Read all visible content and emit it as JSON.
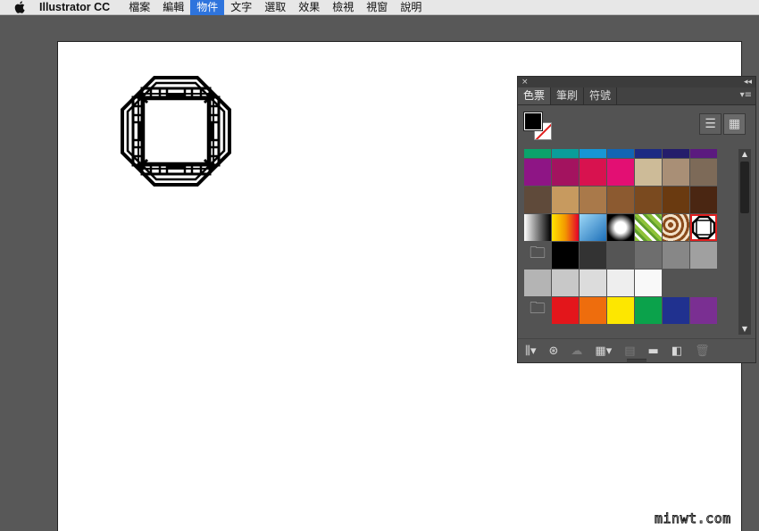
{
  "menubar": {
    "app_name": "Illustrator CC",
    "items": [
      {
        "label": "檔案",
        "active": false
      },
      {
        "label": "編輯",
        "active": false
      },
      {
        "label": "物件",
        "active": true
      },
      {
        "label": "文字",
        "active": false
      },
      {
        "label": "選取",
        "active": false
      },
      {
        "label": "效果",
        "active": false
      },
      {
        "label": "檢視",
        "active": false
      },
      {
        "label": "視窗",
        "active": false
      },
      {
        "label": "說明",
        "active": false
      }
    ]
  },
  "panel": {
    "close_glyph": "×",
    "collapse_glyph": "◂◂",
    "menu_glyph": "▾≡",
    "tabs": [
      {
        "label": "色票",
        "active": true
      },
      {
        "label": "筆刷",
        "active": false
      },
      {
        "label": "符號",
        "active": false
      }
    ],
    "view_list_glyph": "☰",
    "view_grid_glyph": "▦",
    "fill_color": "#000000",
    "stroke": "none",
    "swatch_rows": [
      {
        "kind": "top",
        "cells": [
          "#0aa36b",
          "#0a9d9a",
          "#1796d5",
          "#1265b4",
          "#1c2a83",
          "#241d6b",
          "#5b1a7f"
        ]
      },
      {
        "kind": "color",
        "cells": [
          "#8e1585",
          "#a3135f",
          "#d8124f",
          "#e30f73",
          "#cdbb98",
          "#a98f76",
          "#7d6a58"
        ]
      },
      {
        "kind": "color",
        "cells": [
          "#5f4a3a",
          "#c79a5f",
          "#a9794a",
          "#8c5a30",
          "#7a4a1f",
          "#6a3a10",
          "#4a2612"
        ]
      },
      {
        "kind": "pattern",
        "cells": [
          "gradient-bw",
          "gradient-fire",
          "gradient-blue",
          "gradient-radial",
          "pattern-leaf",
          "pattern-swirl",
          "pattern-octagon"
        ]
      },
      {
        "kind": "gray",
        "cells": [
          "folder",
          "#000000",
          "#333333",
          "#555555",
          "#6e6e6e",
          "#878787",
          "#a0a0a0"
        ]
      },
      {
        "kind": "gray",
        "cells": [
          "#b4b4b4",
          "#c8c8c8",
          "#dcdcdc",
          "#eeeeee",
          "#f9f9f9"
        ]
      },
      {
        "kind": "color",
        "cells": [
          "folder",
          "#e3161b",
          "#ee6d0d",
          "#fde700",
          "#0ba24b",
          "#20318f",
          "#7a2f92"
        ]
      }
    ],
    "footer_icons": [
      "library-icon",
      "swatch-kinds-icon",
      "cloud-icon",
      "new-color-group-icon",
      "swatch-options-icon",
      "new-folder-icon",
      "new-swatch-icon",
      "trash-icon"
    ],
    "footer_glyphs": [
      "⫼▾",
      "⊛",
      "☁",
      "▦▾",
      "▤",
      "▬",
      "◧",
      "🗑"
    ]
  },
  "watermark": "minwt.com"
}
